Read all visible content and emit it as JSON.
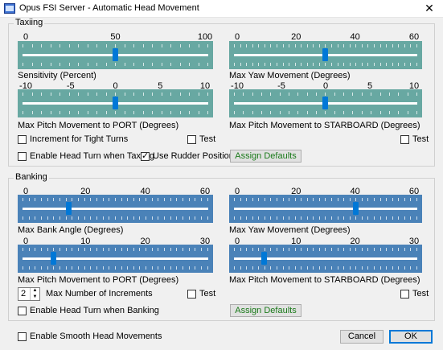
{
  "window": {
    "title": "Opus FSI Server - Automatic Head Movement",
    "close_glyph": "✕"
  },
  "taxiing": {
    "label": "Taxiing",
    "sensitivity": {
      "ticks": [
        "0",
        "50",
        "100"
      ],
      "value_fraction": 0.5,
      "label": "Sensitivity (Percent)"
    },
    "max_yaw": {
      "ticks": [
        "0",
        "20",
        "40",
        "60"
      ],
      "value_fraction": 0.5,
      "label": "Max Yaw Movement (Degrees)"
    },
    "pitch_port": {
      "ticks": [
        "-10",
        "-5",
        "0",
        "5",
        "10"
      ],
      "value_fraction": 0.5,
      "label": "Max Pitch Movement to PORT (Degrees)"
    },
    "pitch_starboard": {
      "ticks": [
        "-10",
        "-5",
        "0",
        "5",
        "10"
      ],
      "value_fraction": 0.5,
      "label": "Max Pitch Movement to STARBOARD (Degrees)"
    },
    "increment_tight_turns": {
      "label": "Increment for Tight Turns",
      "checked": false
    },
    "test_port": {
      "label": "Test",
      "checked": false
    },
    "test_starboard": {
      "label": "Test",
      "checked": false
    },
    "enable_head_turn": {
      "label": "Enable Head Turn when Taxiing",
      "checked": false
    },
    "use_rudder": {
      "label": "Use Rudder Position",
      "checked": true
    },
    "assign_defaults": "Assign Defaults"
  },
  "banking": {
    "label": "Banking",
    "max_bank": {
      "ticks": [
        "0",
        "20",
        "40",
        "60"
      ],
      "value_fraction": 0.25,
      "label": "Max Bank Angle (Degrees)"
    },
    "max_yaw": {
      "ticks": [
        "0",
        "20",
        "40",
        "60"
      ],
      "value_fraction": 0.667,
      "label": "Max Yaw Movement (Degrees)"
    },
    "pitch_port": {
      "ticks": [
        "0",
        "10",
        "20",
        "30"
      ],
      "value_fraction": 0.167,
      "label": "Max Pitch Movement to PORT (Degrees)"
    },
    "pitch_starboard": {
      "ticks": [
        "0",
        "10",
        "20",
        "30"
      ],
      "value_fraction": 0.167,
      "label": "Max Pitch Movement to STARBOARD (Degrees)"
    },
    "increments": {
      "value": "2",
      "label": "Max Number of Increments"
    },
    "test_port": {
      "label": "Test",
      "checked": false
    },
    "test_starboard": {
      "label": "Test",
      "checked": false
    },
    "enable_head_turn": {
      "label": "Enable Head Turn when Banking",
      "checked": false
    },
    "assign_defaults": "Assign Defaults"
  },
  "footer": {
    "smooth": {
      "label": "Enable Smooth Head Movements",
      "checked": false
    },
    "cancel": "Cancel",
    "ok": "OK"
  },
  "colors": {
    "taxi_slider": "#68a8a2",
    "bank_slider": "#4a82b8",
    "thumb": "#0078d7",
    "assign_defaults_text": "#1a7a1a"
  }
}
